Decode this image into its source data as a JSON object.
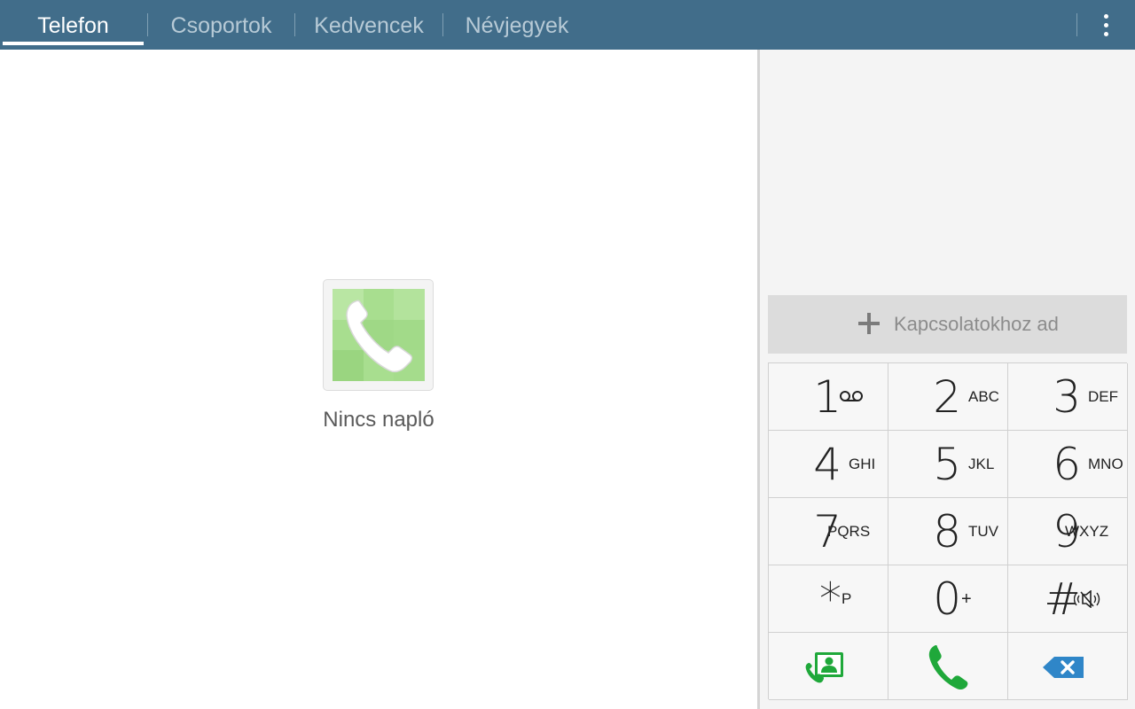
{
  "tabs": [
    {
      "label": "Telefon",
      "active": true
    },
    {
      "label": "Csoportok",
      "active": false
    },
    {
      "label": "Kedvencek",
      "active": false
    },
    {
      "label": "Névjegyek",
      "active": false
    }
  ],
  "overflow_menu_icon": "overflow-menu-icon",
  "call_log": {
    "empty_icon": "phone-handset-icon",
    "empty_text": "Nincs napló"
  },
  "dialer": {
    "number_value": "",
    "add_contact_label": "Kapcsolatokhoz ad",
    "keys": [
      {
        "digit": "1",
        "letters": "",
        "sub_icon": "voicemail-icon"
      },
      {
        "digit": "2",
        "letters": "ABC"
      },
      {
        "digit": "3",
        "letters": "DEF"
      },
      {
        "digit": "4",
        "letters": "GHI"
      },
      {
        "digit": "5",
        "letters": "JKL"
      },
      {
        "digit": "6",
        "letters": "MNO"
      },
      {
        "digit": "7",
        "letters": "PQRS"
      },
      {
        "digit": "8",
        "letters": "TUV"
      },
      {
        "digit": "9",
        "letters": "WXYZ"
      },
      {
        "digit": "*",
        "letters": "P"
      },
      {
        "digit": "0",
        "letters": "+"
      },
      {
        "digit": "#",
        "letters": "",
        "sub_icon": "mute-icon"
      }
    ],
    "bottom_actions": [
      {
        "icon": "contact-card-call-icon"
      },
      {
        "icon": "call-icon"
      },
      {
        "icon": "backspace-icon"
      }
    ]
  },
  "colors": {
    "top_bar": "#416d8a",
    "active_tab": "#ffffff",
    "inactive_tab": "#b7cad6",
    "call_green": "#1fa83a",
    "backspace_blue": "#2f86c8"
  }
}
